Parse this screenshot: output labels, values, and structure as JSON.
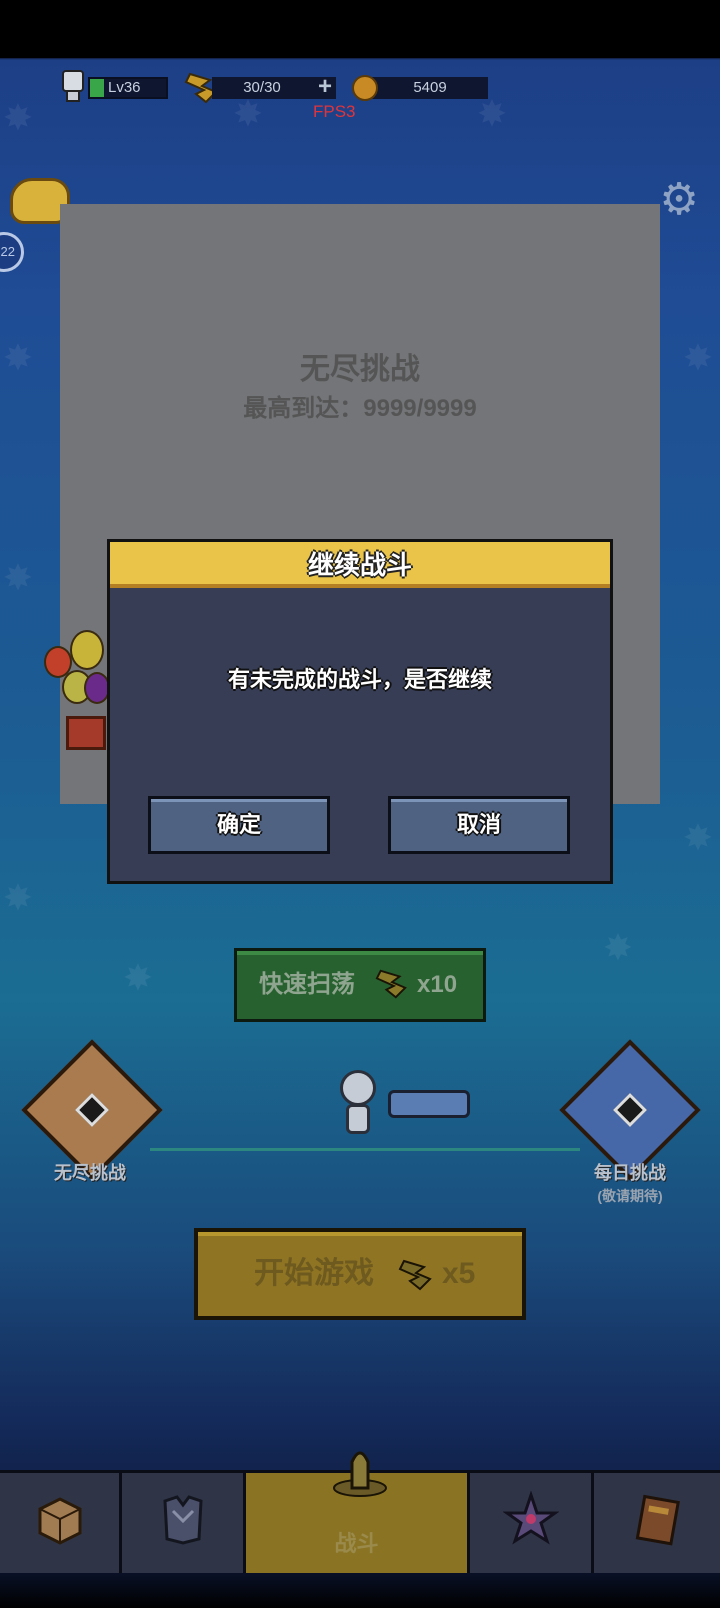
{
  "hud": {
    "level": "Lv36",
    "energy": "30/30",
    "energy_plus": "+",
    "coins": "5409",
    "fps": "FPS3",
    "badge": "22"
  },
  "panel": {
    "title": "无尽挑战",
    "subtitle": "最高到达：9999/9999"
  },
  "dialog": {
    "title": "继续战斗",
    "message": "有未完成的战斗，是否继续",
    "confirm_label": "确定",
    "cancel_label": "取消"
  },
  "sweep": {
    "label": "快速扫荡",
    "count": "x10"
  },
  "modes": {
    "left_label": "无尽挑战",
    "right_label": "每日挑战",
    "right_sub": "(敬请期待)"
  },
  "start": {
    "label": "开始游戏",
    "count": "x5"
  },
  "nav": {
    "items": [
      {
        "icon": "box-icon",
        "label": ""
      },
      {
        "icon": "armor-icon",
        "label": ""
      },
      {
        "icon": "bullet-icon",
        "label": "战斗"
      },
      {
        "icon": "talent-icon",
        "label": ""
      },
      {
        "icon": "book-icon",
        "label": ""
      }
    ]
  },
  "colors": {
    "dialog_header": "#e9c449",
    "dialog_body": "#363d55",
    "button": "#4f6282",
    "fps_text": "#e0343b"
  }
}
